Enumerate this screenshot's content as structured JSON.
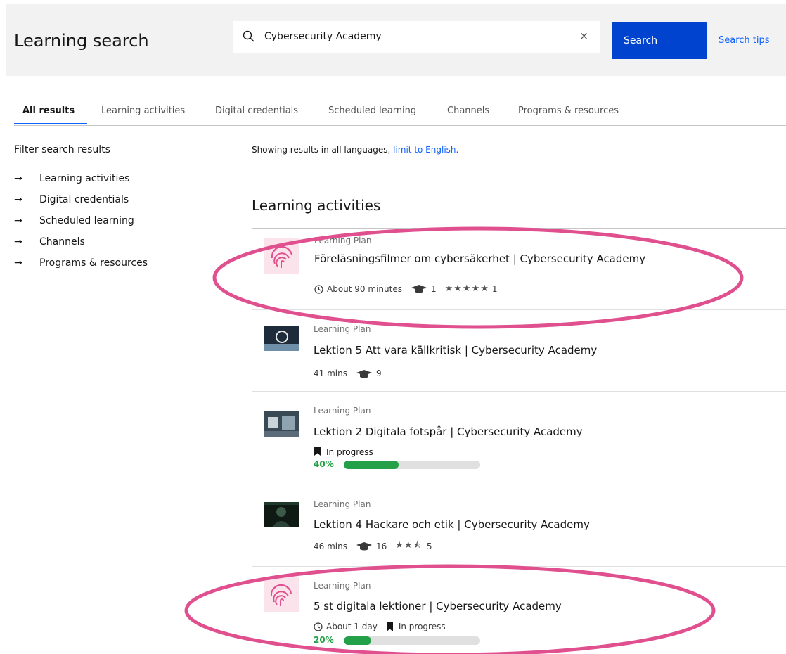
{
  "header": {
    "title": "Learning search",
    "search_value": "Cybersecurity Academy",
    "clear_label": "×",
    "search_button": "Search",
    "search_tips": "Search tips"
  },
  "tabs": [
    "All results",
    "Learning activities",
    "Digital credentials",
    "Scheduled learning",
    "Channels",
    "Programs & resources"
  ],
  "filters": {
    "title": "Filter search results",
    "arrow": "→",
    "items": [
      "Learning activities",
      "Digital credentials",
      "Scheduled learning",
      "Channels",
      "Programs & resources"
    ]
  },
  "results_note": {
    "text": "Showing results in all languages, ",
    "link": "limit to English."
  },
  "section_title": "Learning activities",
  "results": [
    {
      "type": "Learning Plan",
      "title": "Föreläsningsfilmer om cybersäkerhet | Cybersecurity Academy",
      "duration": "About 90 minutes",
      "enrolled": "1",
      "rating_stars": "★★★★★",
      "rating_count": "1",
      "thumb": "fingerprint-icon"
    },
    {
      "type": "Learning Plan",
      "title": "Lektion 5 Att vara källkritisk | Cybersecurity Academy",
      "duration": "41 mins",
      "enrolled": "9",
      "thumb": "video-thumbnail"
    },
    {
      "type": "Learning Plan",
      "title": "Lektion 2 Digitala fotspår | Cybersecurity Academy",
      "status": "In progress",
      "progress_label": "40%",
      "progress": 0.4,
      "thumb": "video-thumbnail"
    },
    {
      "type": "Learning Plan",
      "title": "Lektion 4 Hackare och etik | Cybersecurity Academy",
      "duration": "46 mins",
      "enrolled": "16",
      "rating_stars": "★★⯪",
      "rating_count": "5",
      "thumb": "video-thumbnail"
    },
    {
      "type": "Learning Plan",
      "title": "5 st digitala lektioner | Cybersecurity Academy",
      "duration": "About 1 day",
      "status": "In progress",
      "progress_label": "20%",
      "progress": 0.2,
      "thumb": "fingerprint-icon"
    }
  ],
  "colors": {
    "primary": "#0f62fe",
    "button": "#0043ce",
    "progress": "#24a148",
    "highlight": "#e0508f"
  }
}
